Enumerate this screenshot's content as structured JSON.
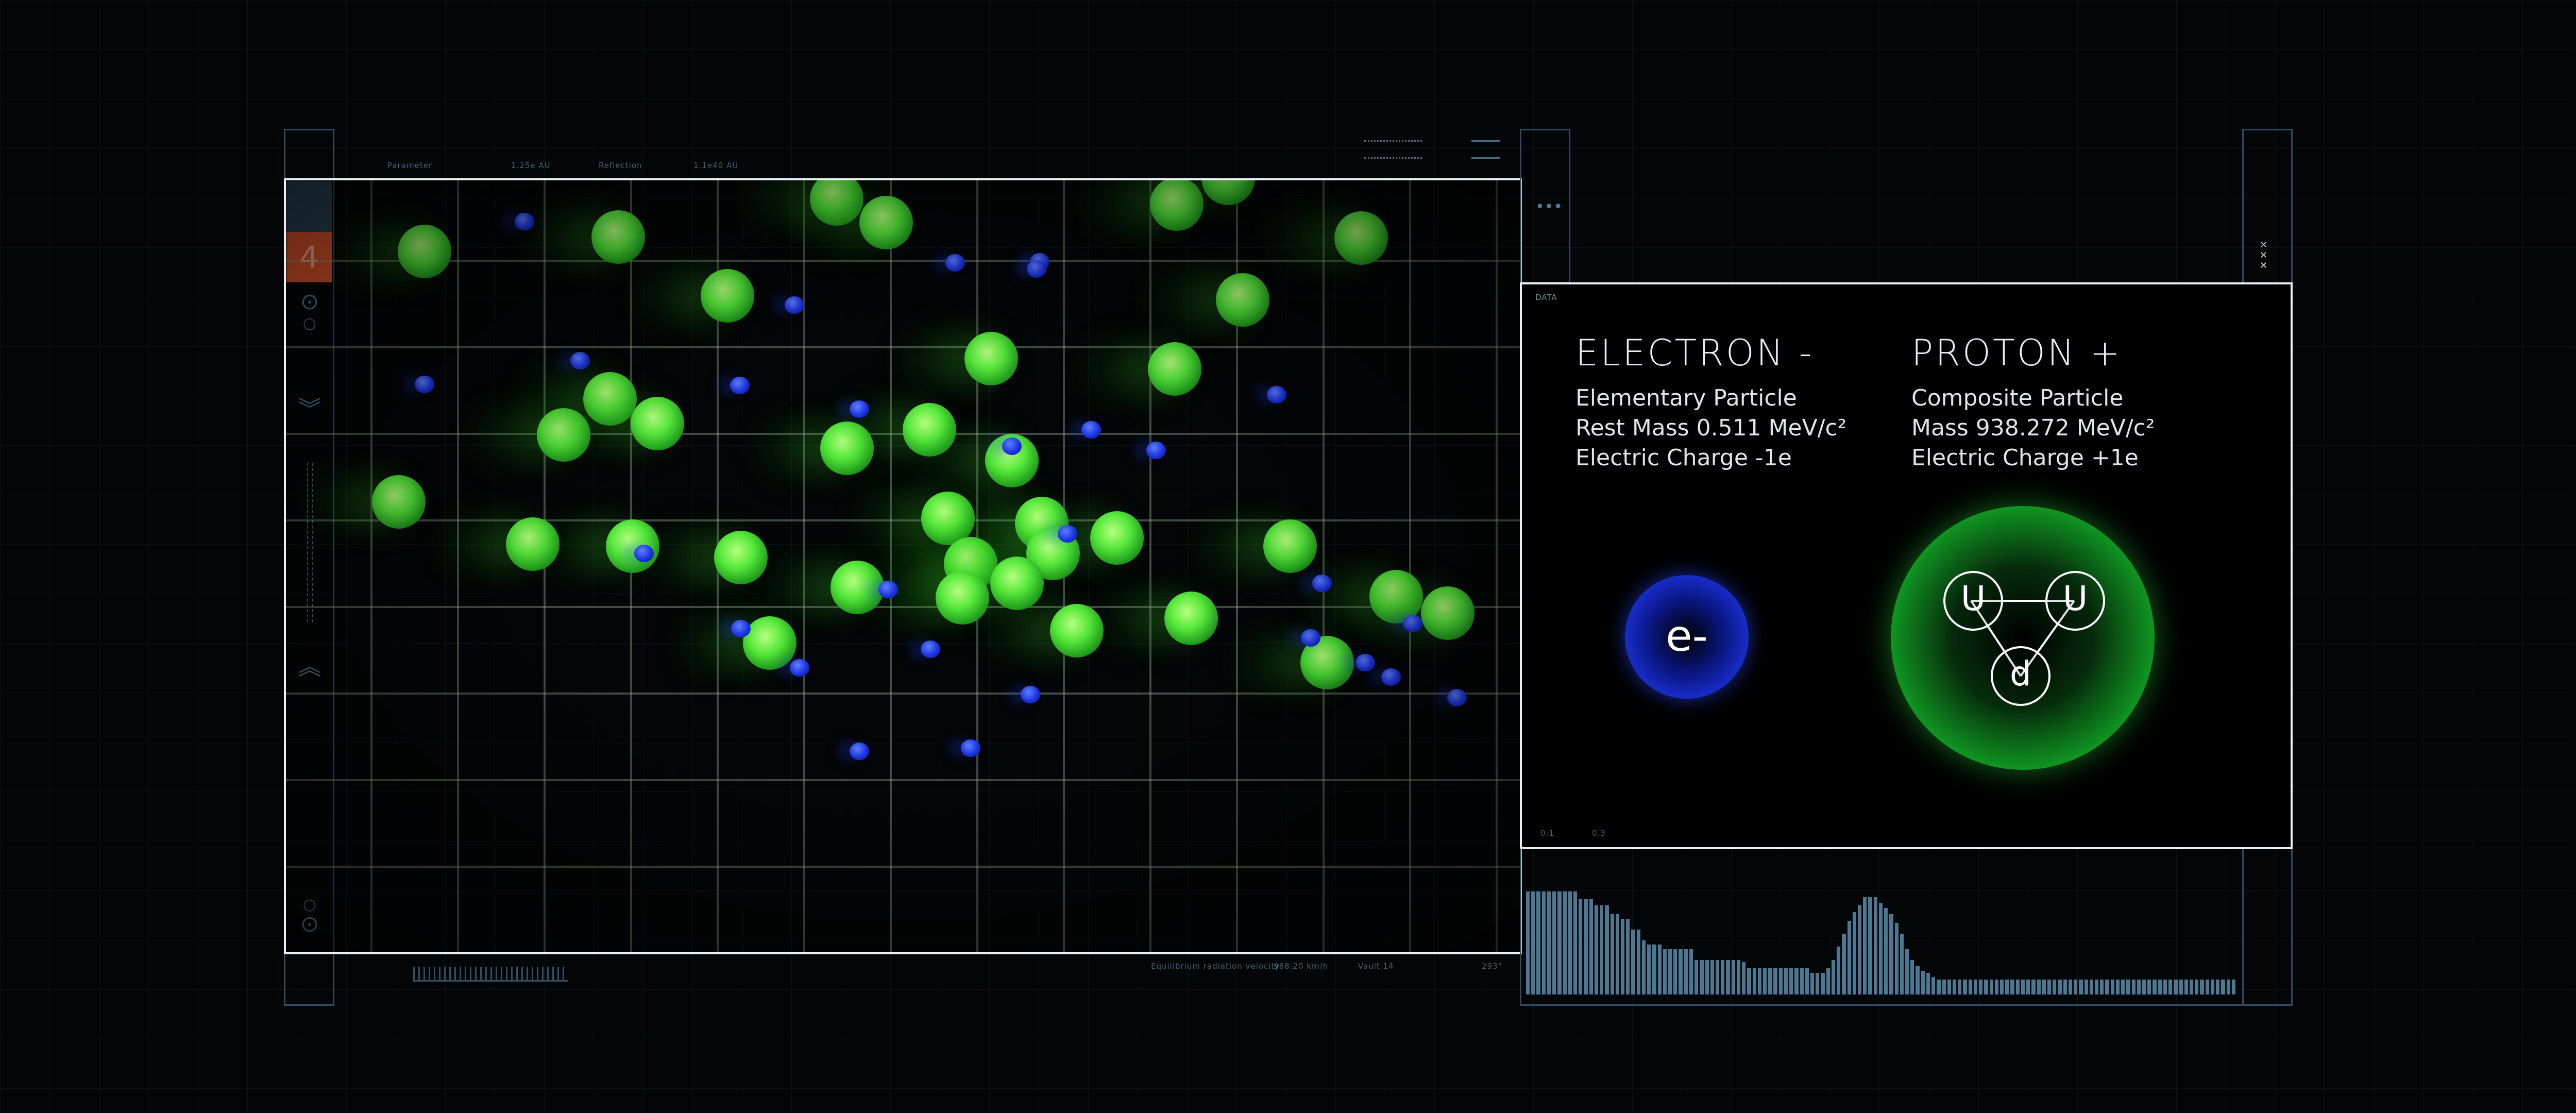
{
  "sim": {
    "hud_labels": [
      "Parameter",
      "1.25e AU",
      "Reflection",
      "1.1e40 AU"
    ],
    "counter": "4",
    "footer_labels": [
      "Equilibrium radiation velocity",
      "968.20 km/h",
      "Vault 14",
      "293°"
    ]
  },
  "data_panel": {
    "label": "DATA",
    "dots": "•••",
    "axis_ticks": [
      "0.1",
      "0.3"
    ],
    "close_glyph": "✕\n✕\n✕",
    "electron": {
      "title": "ELECTRON -",
      "lines": [
        "Elementary Particle",
        "Rest Mass 0.511 MeV/c²",
        "Electric Charge -1e"
      ],
      "symbol": "e-"
    },
    "proton": {
      "title": "PROTON +",
      "lines": [
        "Composite Particle",
        "Mass 938.272 MeV/c²",
        "Electric Charge +1e"
      ],
      "quarks": [
        "U",
        "U",
        "d"
      ]
    }
  },
  "histogram": [
    95,
    95,
    95,
    95,
    95,
    95,
    95,
    95,
    95,
    95,
    88,
    88,
    88,
    82,
    82,
    82,
    74,
    74,
    70,
    70,
    60,
    60,
    50,
    46,
    46,
    46,
    42,
    42,
    42,
    42,
    42,
    42,
    32,
    32,
    32,
    32,
    32,
    32,
    32,
    32,
    32,
    30,
    24,
    24,
    24,
    24,
    24,
    24,
    24,
    24,
    24,
    24,
    24,
    24,
    20,
    20,
    20,
    24,
    32,
    44,
    56,
    68,
    76,
    82,
    90,
    90,
    90,
    84,
    80,
    74,
    66,
    56,
    42,
    32,
    26,
    22,
    20,
    16,
    14,
    14,
    14,
    14,
    14,
    14,
    14,
    14,
    14,
    14,
    14,
    14,
    14,
    14,
    14,
    14,
    14,
    14,
    14,
    14,
    14,
    14,
    14,
    14,
    14,
    14,
    14,
    14,
    14,
    14,
    14,
    14,
    14,
    14,
    14,
    14,
    14,
    14,
    14,
    14,
    14,
    14,
    14,
    14,
    14,
    14,
    14,
    14,
    14,
    14,
    14,
    14,
    14,
    14,
    14,
    14,
    14
  ],
  "colors": {
    "accent_orange": "#e0542c",
    "electron_blue": "#1c34e0",
    "proton_green": "#22e03a",
    "rail": "#2e4b63"
  },
  "icons": [
    "target-icon",
    "chevron-double-down-icon",
    "chevron-double-up-icon",
    "ruler-icon",
    "close-icon"
  ]
}
